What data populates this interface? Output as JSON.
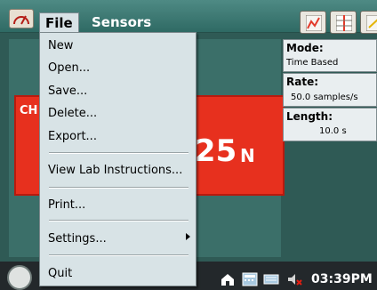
{
  "menubar": {
    "file_label": "File",
    "sensors_label": "Sensors"
  },
  "meter": {
    "channel_label": "CH",
    "value": ".25",
    "unit": "N"
  },
  "info": {
    "mode_label": "Mode:",
    "mode_value": "Time Based",
    "rate_label": "Rate:",
    "rate_value": "50.0 samples/s",
    "length_label": "Length:",
    "length_value": "10.0 s"
  },
  "file_menu": {
    "items": {
      "new": "New",
      "open": "Open...",
      "save": "Save...",
      "delete": "Delete...",
      "export": "Export...",
      "view_lab_instructions": "View Lab Instructions...",
      "print": "Print...",
      "settings": "Settings...",
      "quit": "Quit"
    }
  },
  "taskbar": {
    "time": "03:39PM"
  },
  "icons": {
    "app": "app-meter-icon",
    "graph": "graph-icon",
    "table": "table-icon",
    "notes": "notes-icon",
    "home": "home-icon",
    "calculator": "calculator-icon",
    "keyboard": "keyboard-icon",
    "volume": "volume-icon"
  },
  "colors": {
    "menubar": "#4e8a84",
    "menu_bg": "#d8e3e6",
    "meter_red": "#e7301e",
    "taskbar": "#23282b"
  }
}
